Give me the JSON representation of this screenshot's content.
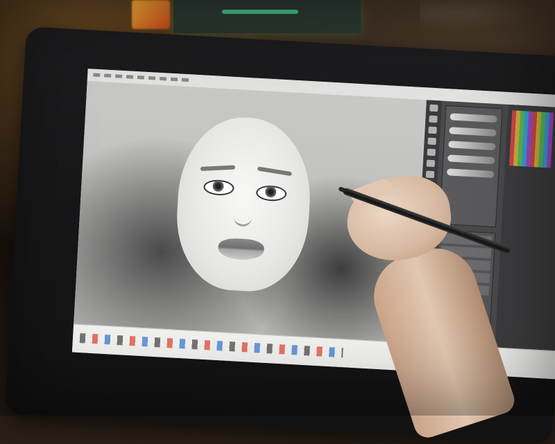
{
  "scene": {
    "subject": "",
    "colors": {
      "room": "#2a1f16",
      "tablet_bezel": "#1c1c1e",
      "screen": "#d8d8d6",
      "skin": "#e2c8b2",
      "pen": "#111111"
    },
    "icons": [
      "brush-icon",
      "layer-icon",
      "swatch-icon",
      "taskbar-app-icon"
    ]
  }
}
